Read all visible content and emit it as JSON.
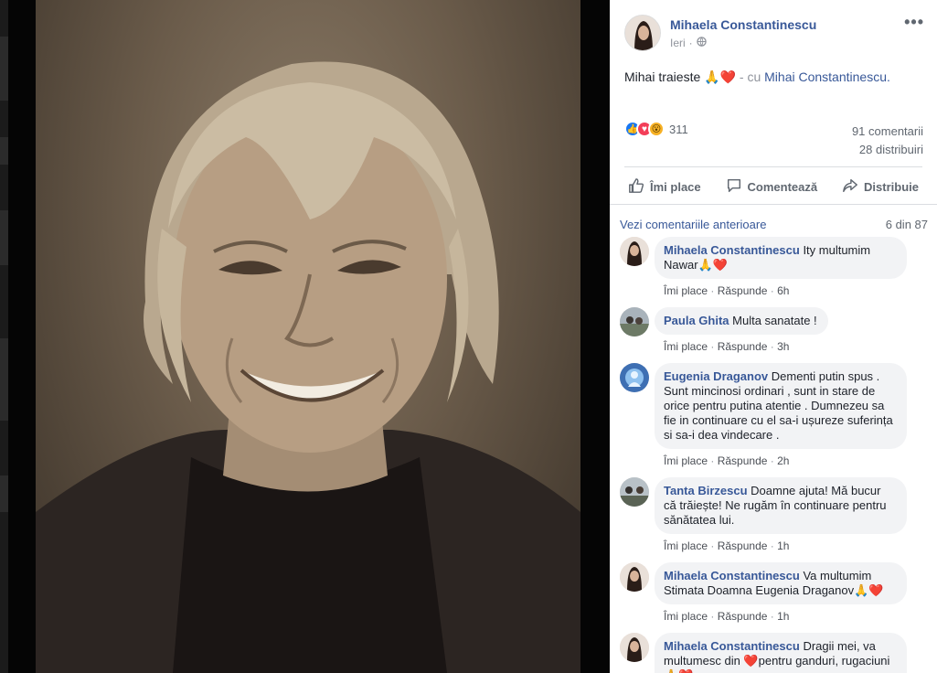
{
  "post": {
    "author": "Mihaela Constantinescu",
    "time": "Ieri",
    "meta_sep": "·",
    "text": "Mihai traieste 🙏❤️",
    "with_sep": " - cu ",
    "tagged": "Mihai Constantinescu.",
    "more": "•••"
  },
  "stats": {
    "reaction_count": "311",
    "comments": "91 comentarii",
    "shares": "28 distribuiri"
  },
  "actions": {
    "like": "Îmi place",
    "comment": "Comentează",
    "share": "Distribuie"
  },
  "comments_header": {
    "previous": "Vezi comentariile anterioare",
    "count": "6 din 87"
  },
  "comments": [
    {
      "name": "Mihaela Constantinescu",
      "text": "Ity multumim Nawar🙏❤️",
      "like": "Îmi place",
      "reply": "Răspunde",
      "sep": "·",
      "time": "6h"
    },
    {
      "name": "Paula Ghita",
      "text": "Multa sanatate !",
      "like": "Îmi place",
      "reply": "Răspunde",
      "sep": "·",
      "time": "3h"
    },
    {
      "name": "Eugenia Draganov",
      "text": "Dementi putin spus . Sunt mincinosi ordinari , sunt in stare de orice pentru putina atentie . Dumnezeu sa fie in continuare cu el sa-i ușureze suferința si sa-i dea vindecare .",
      "like": "Îmi place",
      "reply": "Răspunde",
      "sep": "·",
      "time": "2h"
    },
    {
      "name": "Tanta Birzescu",
      "text": "Doamne ajuta! Mă bucur că trăiește! Ne rugăm în continuare pentru sănătatea lui.",
      "like": "Îmi place",
      "reply": "Răspunde",
      "sep": "·",
      "time": "1h"
    },
    {
      "name": "Mihaela Constantinescu",
      "text": "Va multumim Stimata Doamna Eugenia Draganov🙏❤️",
      "like": "Îmi place",
      "reply": "Răspunde",
      "sep": "·",
      "time": "1h"
    },
    {
      "name": "Mihaela Constantinescu",
      "text": "Dragii mei, va multumesc din ❤️pentru ganduri, rugaciuni🙏❤️",
      "like": "",
      "reply": "",
      "sep": "",
      "time": ""
    }
  ],
  "colors": {
    "link": "#385898",
    "muted": "#90949c",
    "bubble": "#f2f3f5",
    "like": "#1877f2",
    "love": "#f33e58",
    "wow": "#f7b125"
  },
  "icons": [
    "globe-icon",
    "thumbs-up-icon",
    "comment-icon",
    "share-icon",
    "more-icon"
  ]
}
